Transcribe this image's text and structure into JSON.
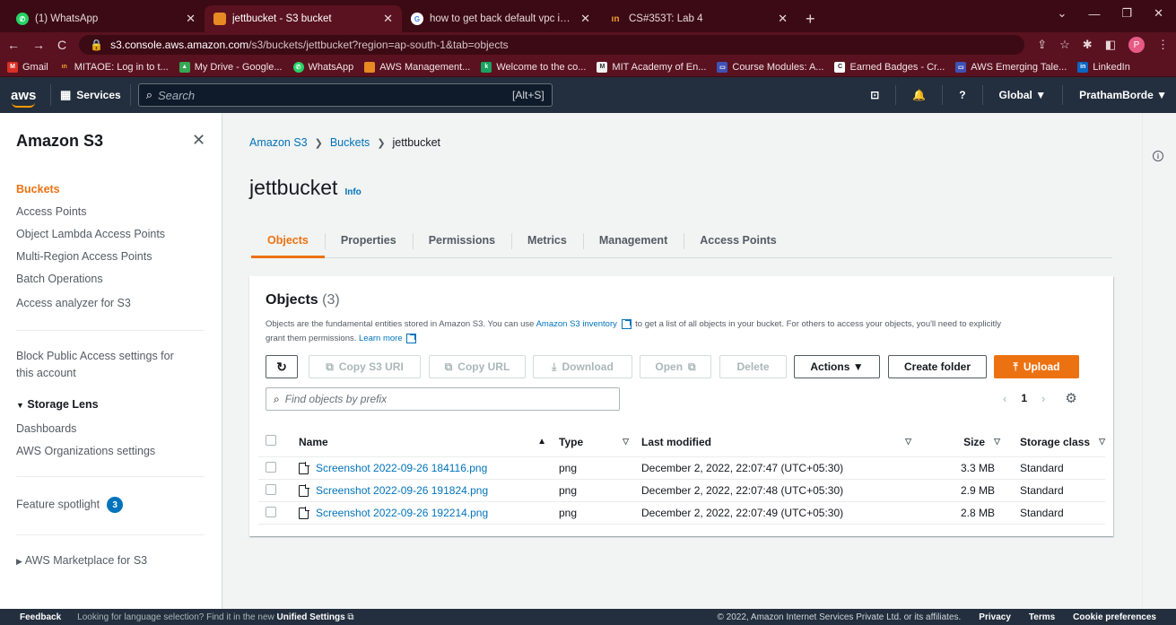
{
  "browser": {
    "tabs": [
      {
        "title": "(1) WhatsApp",
        "icon": "whatsapp-icon",
        "active": false
      },
      {
        "title": "jettbucket - S3 bucket",
        "icon": "s3-icon",
        "active": true
      },
      {
        "title": "how to get back default vpc in aw",
        "icon": "google-icon",
        "active": false
      },
      {
        "title": "CS#353T: Lab 4",
        "icon": "in-icon",
        "active": false
      }
    ],
    "url_host": "s3.console.aws.amazon.com",
    "url_path": "/s3/buckets/jettbucket?region=ap-south-1&tab=objects",
    "profile_initial": "P",
    "bookmarks": [
      "Gmail",
      "MITAOE: Log in to t...",
      "My Drive - Google...",
      "WhatsApp",
      "AWS Management...",
      "Welcome to the co...",
      "MIT Academy of En...",
      "Course Modules: A...",
      "Earned Badges - Cr...",
      "AWS Emerging Tale...",
      "LinkedIn"
    ]
  },
  "aws": {
    "logo": "aws",
    "services_label": "Services",
    "search_placeholder": "Search",
    "search_shortcut": "[Alt+S]",
    "region": "Global ▼",
    "user": "PrathamBorde ▼"
  },
  "sidebar": {
    "title": "Amazon S3",
    "items": [
      "Buckets",
      "Access Points",
      "Object Lambda Access Points",
      "Multi-Region Access Points",
      "Batch Operations",
      "Access analyzer for S3"
    ],
    "block_public": "Block Public Access settings for",
    "block_public2": "this account",
    "storage_lens": "Storage Lens",
    "storage_lens_items": [
      "Dashboards",
      "AWS Organizations settings"
    ],
    "feature_spotlight": "Feature spotlight",
    "feature_badge": "3",
    "marketplace": "AWS Marketplace for S3"
  },
  "breadcrumb": [
    "Amazon S3",
    "Buckets",
    "jettbucket"
  ],
  "bucket": {
    "name": "jettbucket",
    "info": "Info"
  },
  "tabs": [
    "Objects",
    "Properties",
    "Permissions",
    "Metrics",
    "Management",
    "Access Points"
  ],
  "objects": {
    "title": "Objects",
    "count": "(3)",
    "desc_1": "Objects are the fundamental entities stored in Amazon S3. You can use",
    "desc_link": "Amazon S3 inventory",
    "desc_2": "to get a list of all objects in your bucket. For others to access your objects, you'll need to explicitly",
    "desc_3": "grant them permissions.",
    "learn_more": "Learn more",
    "buttons": {
      "copy_uri": "Copy S3 URI",
      "copy_url": "Copy URL",
      "download": "Download",
      "open": "Open",
      "delete": "Delete",
      "actions": "Actions ▼",
      "create_folder": "Create folder",
      "upload": "Upload"
    },
    "search_placeholder": "Find objects by prefix",
    "page": "1",
    "columns": {
      "name": "Name",
      "type": "Type",
      "modified": "Last modified",
      "size": "Size",
      "storage": "Storage class"
    },
    "rows": [
      {
        "name": "Screenshot 2022-09-26 184116.png",
        "type": "png",
        "modified": "December 2, 2022, 22:07:47 (UTC+05:30)",
        "size": "3.3 MB",
        "storage": "Standard"
      },
      {
        "name": "Screenshot 2022-09-26 191824.png",
        "type": "png",
        "modified": "December 2, 2022, 22:07:48 (UTC+05:30)",
        "size": "2.9 MB",
        "storage": "Standard"
      },
      {
        "name": "Screenshot 2022-09-26 192214.png",
        "type": "png",
        "modified": "December 2, 2022, 22:07:49 (UTC+05:30)",
        "size": "2.8 MB",
        "storage": "Standard"
      }
    ]
  },
  "footer": {
    "feedback": "Feedback",
    "hint": "Looking for language selection? Find it in the new",
    "hint_bold": "Unified Settings",
    "copyright": "© 2022, Amazon Internet Services Private Ltd. or its affiliates.",
    "privacy": "Privacy",
    "terms": "Terms",
    "cookies": "Cookie preferences"
  },
  "colors": {
    "accent": "#ec7211",
    "link": "#0073bb",
    "aws_nav": "#232f3e",
    "browser_frame": "#5a1220"
  }
}
